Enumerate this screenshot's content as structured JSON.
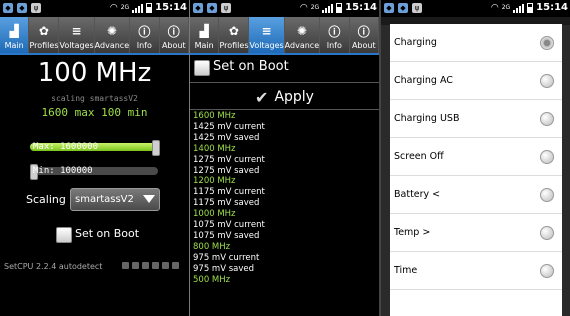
{
  "status": {
    "time": "15:14",
    "network": "2G",
    "left_icons": [
      "shield-icon",
      "shield-icon",
      "usb-icon"
    ],
    "wifi_icon": "wifi-icon"
  },
  "tabs": [
    {
      "label": "Main",
      "icon": "main-icon"
    },
    {
      "label": "Profiles",
      "icon": "gear-icon"
    },
    {
      "label": "Voltages",
      "icon": "voltages-icon"
    },
    {
      "label": "Advance",
      "icon": "gear-icon"
    },
    {
      "label": "Info",
      "icon": "info-icon"
    },
    {
      "label": "About",
      "icon": "info-icon"
    }
  ],
  "main": {
    "frequency": "100 MHz",
    "governor_text": "scaling smartassV2",
    "max_min": "1600 max 100 min",
    "max_slider_label": "Max: 1600000",
    "max_slider_fraction": 1.0,
    "min_slider_label": "Min: 100000",
    "min_slider_fraction": 0.0,
    "scaling_label": "Scaling",
    "scaling_value": "smartassV2",
    "set_on_boot": "Set on Boot",
    "footer": "SetCPU 2.2.4 autodetect"
  },
  "voltages": {
    "set_on_boot": "Set on Boot",
    "apply": "Apply",
    "entries": [
      {
        "freq": "1600 MHz",
        "current": "1425 mV current",
        "saved": "1425 mV saved"
      },
      {
        "freq": "1400 MHz",
        "current": "1275 mV current",
        "saved": "1275 mV saved"
      },
      {
        "freq": "1200 MHz",
        "current": "1175 mV current",
        "saved": "1175 mV saved"
      },
      {
        "freq": "1000 MHz",
        "current": "1075 mV current",
        "saved": "1075 mV saved"
      },
      {
        "freq": "800 MHz",
        "current": "975 mV current",
        "saved": "975 mV saved"
      },
      {
        "freq": "500 MHz"
      }
    ]
  },
  "profiles_menu": {
    "items": [
      {
        "label": "Charging",
        "selected": true
      },
      {
        "label": "Charging AC",
        "selected": false
      },
      {
        "label": "Charging USB",
        "selected": false
      },
      {
        "label": "Screen Off",
        "selected": false
      },
      {
        "label": "Battery <",
        "selected": false
      },
      {
        "label": "Temp >",
        "selected": false
      },
      {
        "label": "Time",
        "selected": false
      }
    ]
  },
  "colors": {
    "accent_green": "#9ee04a",
    "active_tab": "#2a76c8"
  }
}
